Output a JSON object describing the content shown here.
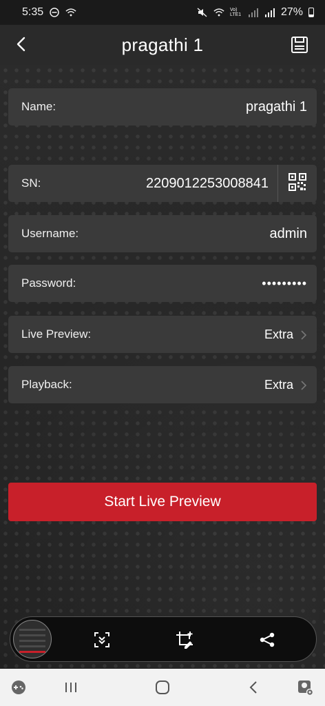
{
  "status_bar": {
    "time": "5:35",
    "battery": "27%",
    "network_label": "Vo)\nLTE1",
    "battery_level": 0.27
  },
  "app_bar": {
    "title": "pragathi 1",
    "back_icon": "chevron-left-icon",
    "save_icon": "save-icon"
  },
  "form": {
    "name": {
      "label": "Name:",
      "value": "pragathi 1"
    },
    "sn": {
      "label": "SN:",
      "value": "2209012253008841",
      "icon": "qr-code-icon"
    },
    "username": {
      "label": "Username:",
      "value": "admin"
    },
    "password": {
      "label": "Password:",
      "value": "•••••••••"
    },
    "live_preview": {
      "label": "Live Preview:",
      "value": "Extra"
    },
    "playback": {
      "label": "Playback:",
      "value": "Extra"
    }
  },
  "primary_action": {
    "label": "Start Live Preview",
    "color": "#c8202a"
  },
  "screenshot_toolbar": {
    "items": [
      "scroll-capture-icon",
      "crop-edit-icon",
      "share-icon"
    ]
  },
  "system_nav": {
    "items": [
      "game-launcher-icon",
      "recent-apps-icon",
      "home-icon",
      "back-icon",
      "assistant-icon"
    ]
  }
}
